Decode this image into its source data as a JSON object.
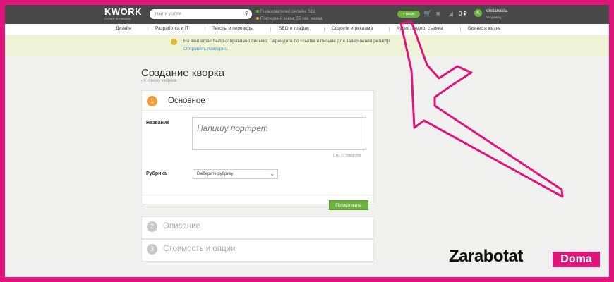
{
  "header": {
    "logo": "KWORK",
    "logo_tagline": "СУПЕР ФРИЛАНС",
    "search_placeholder": "Найти услуги",
    "stats_online": "Пользователей онлайн: 512",
    "stats_last_order": "Последний заказ: 55 сек. назад",
    "kwork_button": "+ кворк",
    "balance": "0 ₽",
    "avatar_letter": "K",
    "username": "kristianakila",
    "user_role": "ПРОДАВЕЦ"
  },
  "categories": [
    "Дизайн",
    "Разработка и IT",
    "Тексты и переводы",
    "SEO и трафик",
    "Соцсети и реклама",
    "Аудио, видео, съемка",
    "Бизнес и жизнь"
  ],
  "notice": {
    "text": "На ваш email было отправлено письмо. Перейдите по ссылке в письме для завершения регистр",
    "link": "Отправить повторно."
  },
  "page": {
    "title": "Создание кворка",
    "back_link": "‹ К списку кворков"
  },
  "steps": [
    {
      "number": "1",
      "title": "Основное"
    },
    {
      "number": "2",
      "title": "Описание"
    },
    {
      "number": "3",
      "title": "Стоимость и опции"
    }
  ],
  "form": {
    "name_label": "Название",
    "name_value": "Напишу портрет",
    "char_count": "0 из 70 символов",
    "rubric_label": "Рубрика",
    "rubric_value": "Выберите рубрику",
    "next_button": "Продолжить"
  },
  "watermark": {
    "text": "Zarabotat",
    "badge": "Doma"
  },
  "colors": {
    "frame": "#e0147a",
    "header": "#484848",
    "accent_green": "#6fb23f",
    "step_active": "#f39c33",
    "notice_bg": "#eef3d8",
    "arrow": "#e0147a"
  },
  "icons": [
    "search-icon",
    "cart-icon",
    "chat-icon",
    "megaphone-icon",
    "warning-icon",
    "chevron-down-icon"
  ]
}
